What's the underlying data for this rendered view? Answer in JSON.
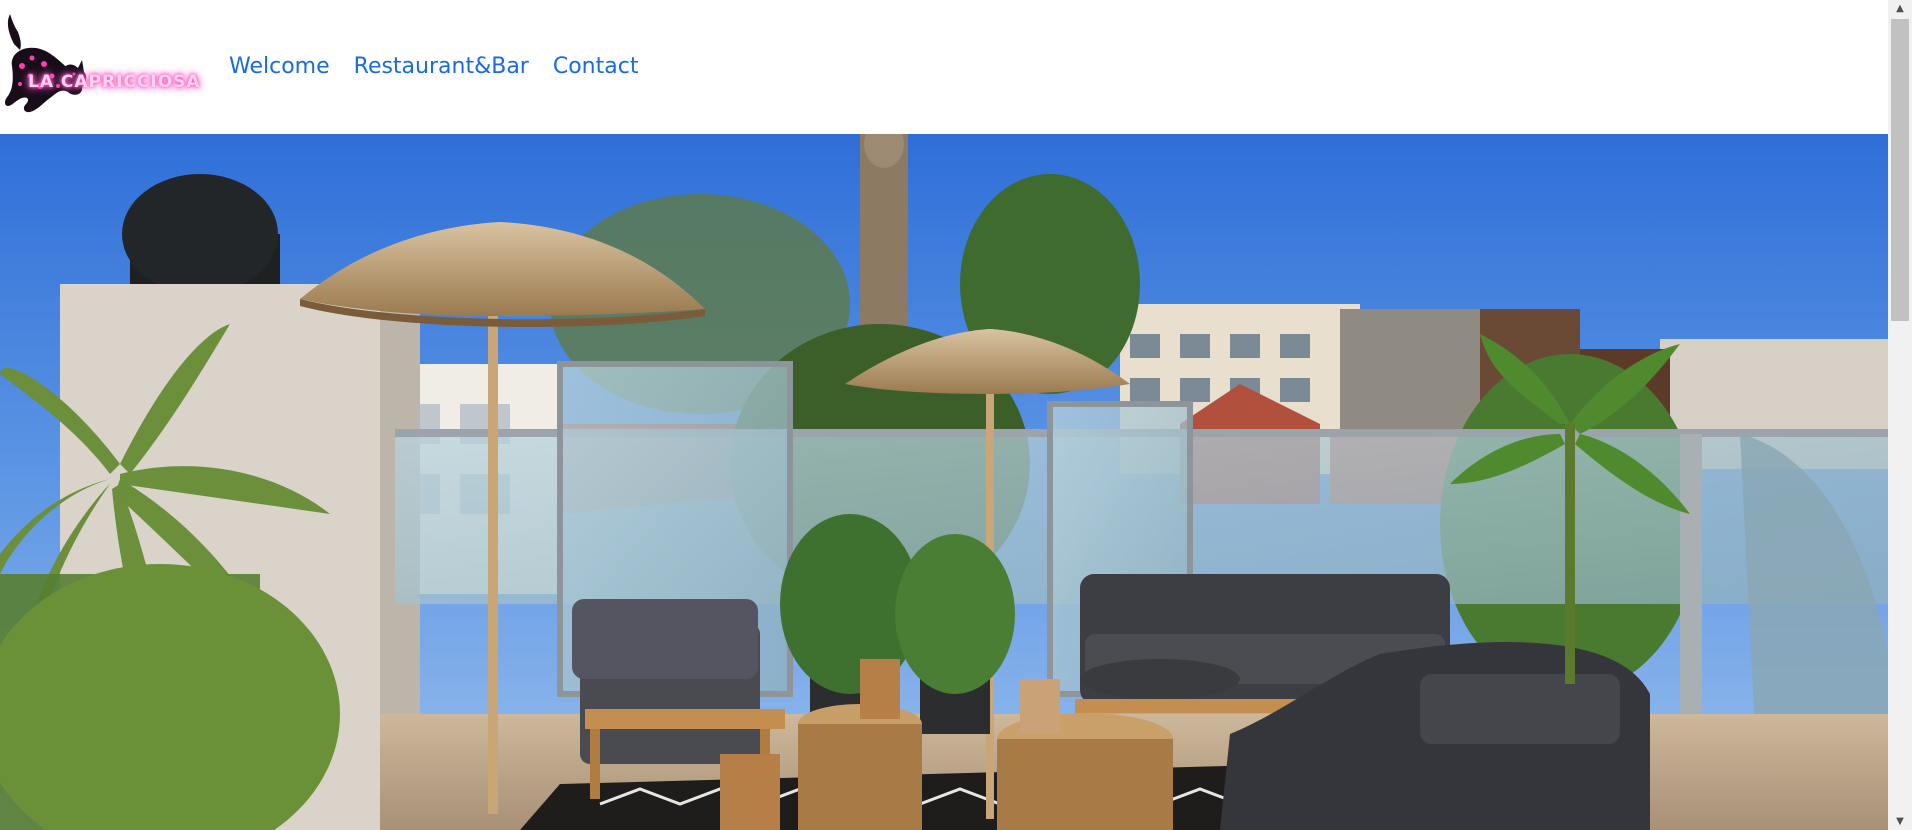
{
  "logo": {
    "text": "LA CAPRICCIOSA",
    "icon": "black-cat-with-pink-spots",
    "glow_color": "#ff4fc0"
  },
  "nav": {
    "items": [
      {
        "label": "Welcome"
      },
      {
        "label": "Restaurant&Bar"
      },
      {
        "label": "Contact"
      }
    ],
    "link_color": "#1a6ae6"
  },
  "hero": {
    "scene": "rooftop-terrace-photo"
  },
  "scrollbar": {
    "up_icon": "triangle-up",
    "down_icon": "triangle-down"
  }
}
